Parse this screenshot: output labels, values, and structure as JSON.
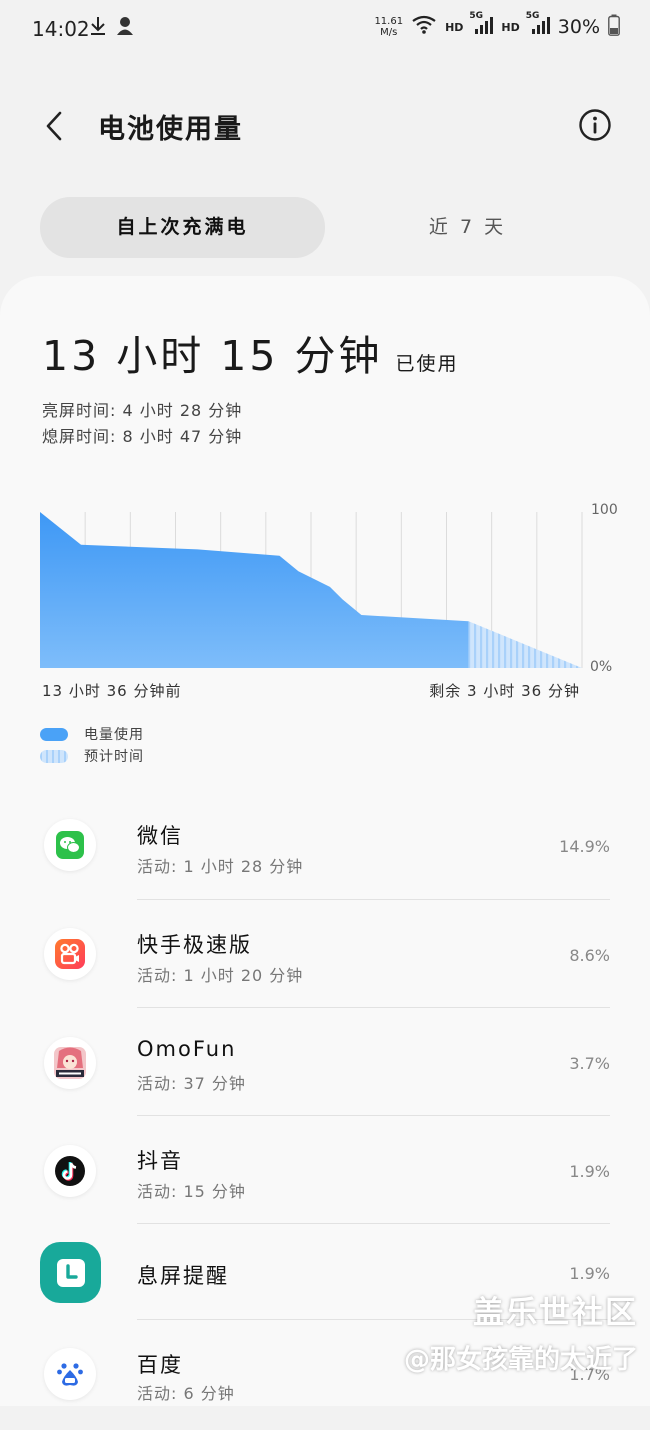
{
  "status_bar": {
    "time": "14:02",
    "speed_value": "11.61",
    "speed_unit": "M/s",
    "hd_label_1": "HD",
    "hd_label_2": "HD",
    "net_label_1": "5G",
    "net_label_2": "5G",
    "battery": "30%"
  },
  "header": {
    "title": "电池使用量"
  },
  "tabs": [
    {
      "label": "自上次充满电",
      "active": true
    },
    {
      "label": "近 7 天",
      "active": false
    }
  ],
  "summary": {
    "total_time": "13 小时 15 分钟",
    "total_suffix": "已使用",
    "screen_on": "亮屏时间: 4 小时 28 分钟",
    "screen_off": "熄屏时间: 8 小时 47 分钟"
  },
  "chart_data": {
    "type": "area",
    "y_max_label": "100",
    "y_min_label": "0%",
    "ylim": [
      0,
      100
    ],
    "x_start_label": "13 小时 36 分钟前",
    "x_end_label": "剩余 3 小时 36 分钟",
    "series": [
      {
        "name": "电量使用",
        "color": "#4aa2f7",
        "x_hours": [
          0,
          1.3,
          5.0,
          7.6,
          8.2,
          8.6,
          8.8,
          9.2,
          9.6,
          10.2,
          13.6
        ],
        "percent": [
          100,
          79,
          76,
          72,
          62,
          58,
          56,
          52,
          44,
          34,
          30
        ]
      },
      {
        "name": "预计时间",
        "color": "#bcdcfb",
        "x_hours": [
          13.6,
          17.2
        ],
        "percent": [
          30,
          0
        ]
      }
    ],
    "grid": true
  },
  "legend": [
    {
      "label": "电量使用",
      "style": "solid",
      "color": "#4aa2f7"
    },
    {
      "label": "预计时间",
      "style": "striped",
      "color": "#bcdcfb"
    }
  ],
  "apps": [
    {
      "name": "微信",
      "activity": "活动: 1 小时 28 分钟",
      "percent": "14.9%",
      "icon": "wechat-icon"
    },
    {
      "name": "快手极速版",
      "activity": "活动: 1 小时 20 分钟",
      "percent": "8.6%",
      "icon": "kuaishou-icon"
    },
    {
      "name": "OmoFun",
      "activity": "活动: 37 分钟",
      "percent": "3.7%",
      "icon": "omofun-icon"
    },
    {
      "name": "抖音",
      "activity": "活动: 15 分钟",
      "percent": "1.9%",
      "icon": "douyin-icon"
    },
    {
      "name": "息屏提醒",
      "activity": "",
      "percent": "1.9%",
      "icon": "clock-icon"
    },
    {
      "name": "百度",
      "activity": "活动: 6 分钟",
      "percent": "1.7%",
      "icon": "baidu-icon"
    }
  ],
  "watermark": {
    "line1": "盖乐世社区",
    "line2": "@那女孩靠的太近了"
  }
}
